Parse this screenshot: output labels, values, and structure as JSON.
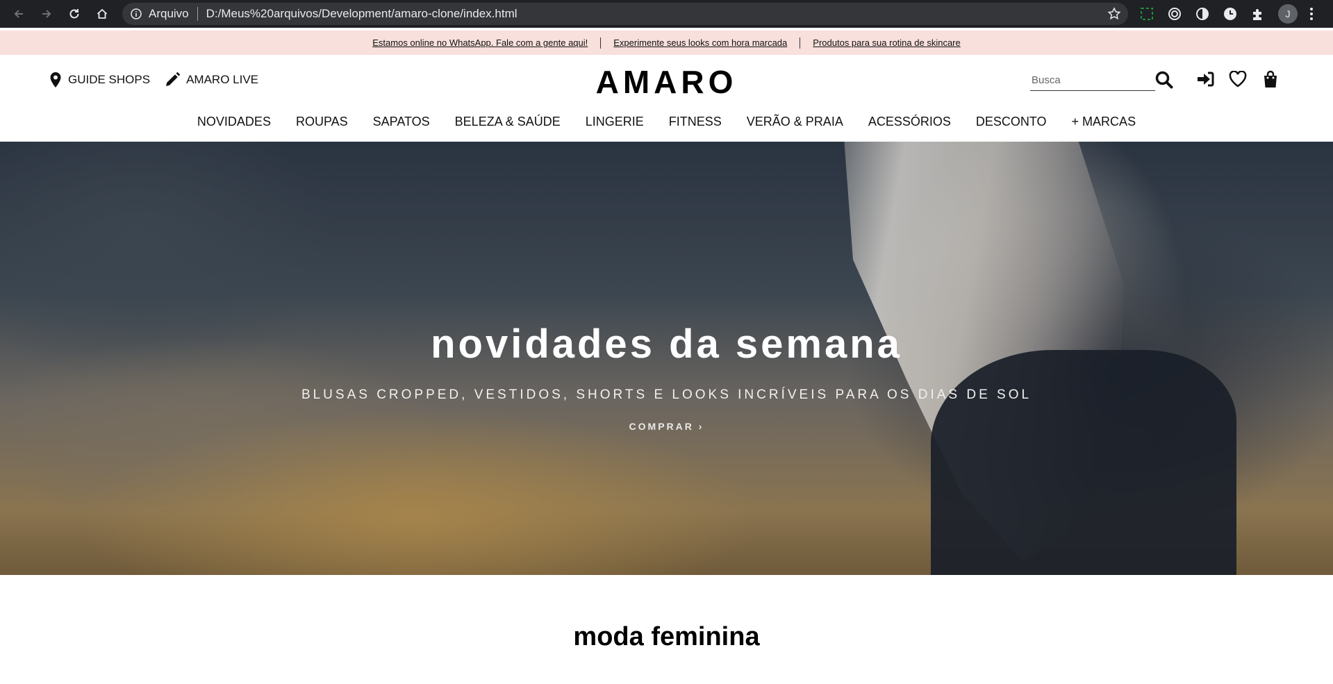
{
  "browser": {
    "scheme_label": "Arquivo",
    "url": "D:/Meus%20arquivos/Development/amaro-clone/index.html",
    "profile_initial": "J"
  },
  "promo": {
    "links": [
      "Estamos online no WhatsApp. Fale com a gente aqui!",
      "Experimente seus looks com hora marcada",
      "Produtos para sua rotina de skincare"
    ]
  },
  "header": {
    "left_links": [
      "GUIDE SHOPS",
      "AMARO LIVE"
    ],
    "logo": "AMARO",
    "search_placeholder": "Busca"
  },
  "menu": {
    "items": [
      "NOVIDADES",
      "ROUPAS",
      "SAPATOS",
      "BELEZA & SAÚDE",
      "LINGERIE",
      "FITNESS",
      "VERÃO & PRAIA",
      "ACESSÓRIOS",
      "DESCONTO",
      "+ MARCAS"
    ]
  },
  "hero": {
    "title": "novidades da semana",
    "subtitle": "BLUSAS CROPPED, VESTIDOS, SHORTS E LOOKS INCRÍVEIS PARA OS DIAS DE SOL",
    "cta": "COMPRAR ›"
  },
  "section": {
    "title": "moda feminina"
  }
}
